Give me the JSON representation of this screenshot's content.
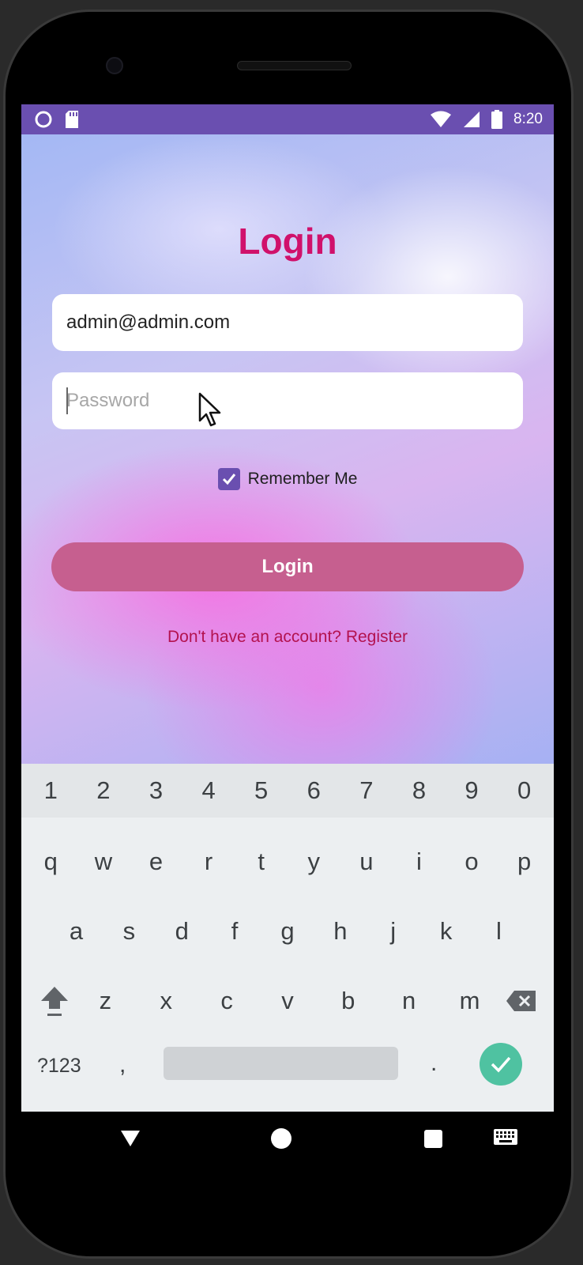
{
  "status_bar": {
    "time": "8:20",
    "icons": [
      "circle-notification-icon",
      "sd-card-icon",
      "wifi-icon",
      "signal-icon",
      "battery-icon"
    ]
  },
  "login": {
    "title": "Login",
    "email_value": "admin@admin.com",
    "password_placeholder": "Password",
    "remember_me_label": "Remember Me",
    "remember_me_checked": true,
    "login_button_label": "Login",
    "register_text": "Don't have an account? Register"
  },
  "keyboard": {
    "number_row": [
      "1",
      "2",
      "3",
      "4",
      "5",
      "6",
      "7",
      "8",
      "9",
      "0"
    ],
    "row1": [
      "q",
      "w",
      "e",
      "r",
      "t",
      "y",
      "u",
      "i",
      "o",
      "p"
    ],
    "row2": [
      "a",
      "s",
      "d",
      "f",
      "g",
      "h",
      "j",
      "k",
      "l"
    ],
    "row3": [
      "z",
      "x",
      "c",
      "v",
      "b",
      "n",
      "m"
    ],
    "symbols_key": "?123",
    "comma_key": ",",
    "period_key": "."
  },
  "colors": {
    "status_bar": "#6a4fb0",
    "title": "#d0116b",
    "login_button": "#c65f8f",
    "register_link": "#b3124f",
    "checkbox": "#6a4fb0",
    "enter_key": "#4fc2a1"
  }
}
